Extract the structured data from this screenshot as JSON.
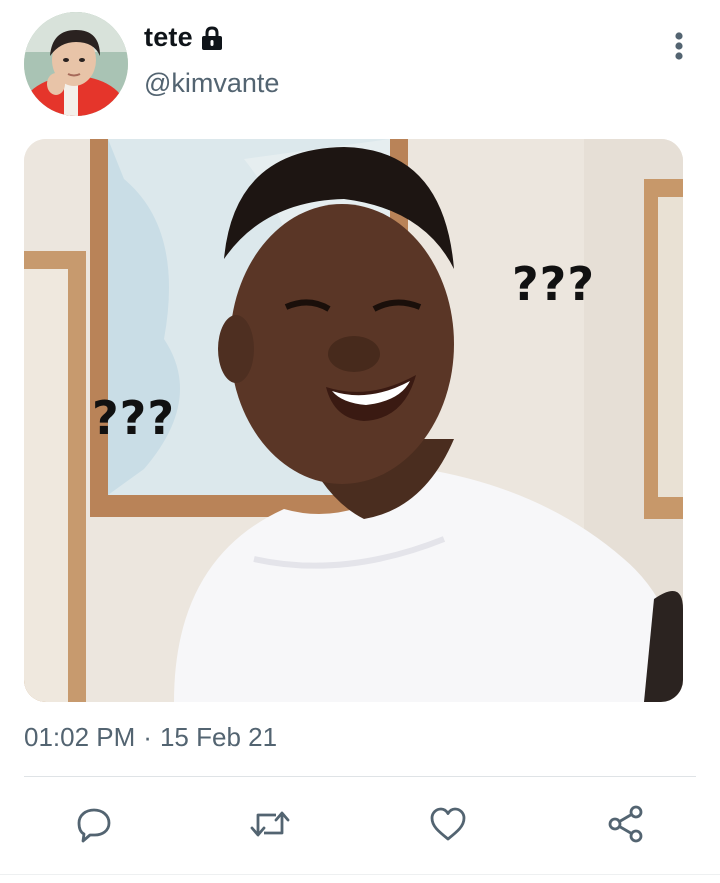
{
  "author": {
    "display_name": "tete",
    "handle": "@kimvante",
    "protected": true,
    "avatar_icon": "profile-photo"
  },
  "media": {
    "captions": [
      "???",
      "???"
    ]
  },
  "meta": {
    "time": "01:02 PM",
    "separator": "·",
    "date": "15 Feb 21"
  },
  "actions": {
    "icons": [
      "reply-icon",
      "retweet-icon",
      "like-icon",
      "share-icon"
    ]
  },
  "colors": {
    "text_primary": "#0f1419",
    "text_secondary": "#536471",
    "divider": "#dfe3e6"
  }
}
